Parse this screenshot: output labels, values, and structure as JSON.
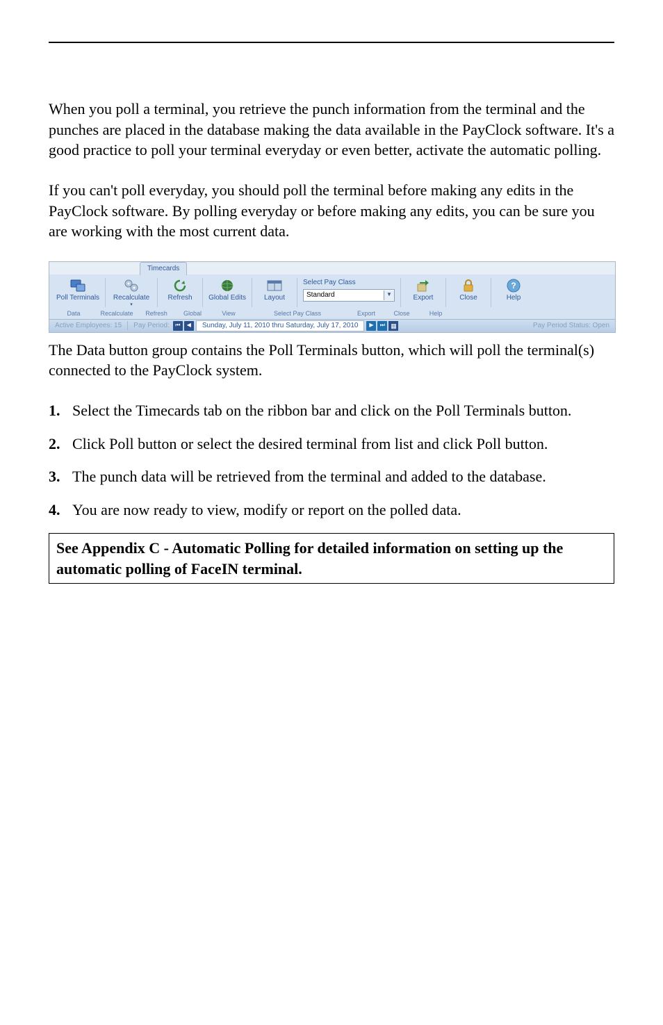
{
  "paragraphs": {
    "p1": "When you poll a terminal, you retrieve the punch information from the terminal and the punches are placed in the database making the data available in the PayClock software. It's a good practice to poll your terminal everyday or even better, activate the automatic polling.",
    "p2": "If you can't poll everyday, you should poll the terminal before making any edits in the PayClock software. By polling everyday or before making any edits, you can be sure you are working with the most current data.",
    "p3": "The Data button group contains the Poll Terminals button, which will poll the terminal(s) connected to the PayClock system."
  },
  "ribbon": {
    "tab": "Timecards",
    "buttons": {
      "poll": "Poll Terminals",
      "recalc": "Recalculate",
      "refresh": "Refresh",
      "global": "Global Edits",
      "layout": "Layout",
      "export": "Export",
      "close": "Close",
      "help": "Help"
    },
    "payclass": {
      "label": "Select Pay Class",
      "value": "Standard"
    },
    "groups": {
      "data": "Data",
      "recalc": "Recalculate",
      "refresh": "Refresh",
      "global": "Global",
      "view": "View",
      "selpay": "Select Pay Class",
      "export": "Export",
      "close": "Close",
      "help": "Help"
    },
    "statusbar": {
      "employees": "Active Employees: 15",
      "payperiod_label": "Pay Period:",
      "date_range": "Sunday, July 11, 2010 thru Saturday, July 17, 2010",
      "status": "Pay Period Status: Open"
    }
  },
  "steps": [
    "Select the Timecards tab on the ribbon bar and click on the Poll Terminals button.",
    "Click Poll button or select the desired terminal from list and click Poll button.",
    "The punch data will be retrieved from the terminal and added to the database.",
    "You are now ready to view, modify or report on the polled data."
  ],
  "appendix": "See Appendix C - Automatic Polling for detailed information on setting up the automatic polling of FaceIN terminal."
}
